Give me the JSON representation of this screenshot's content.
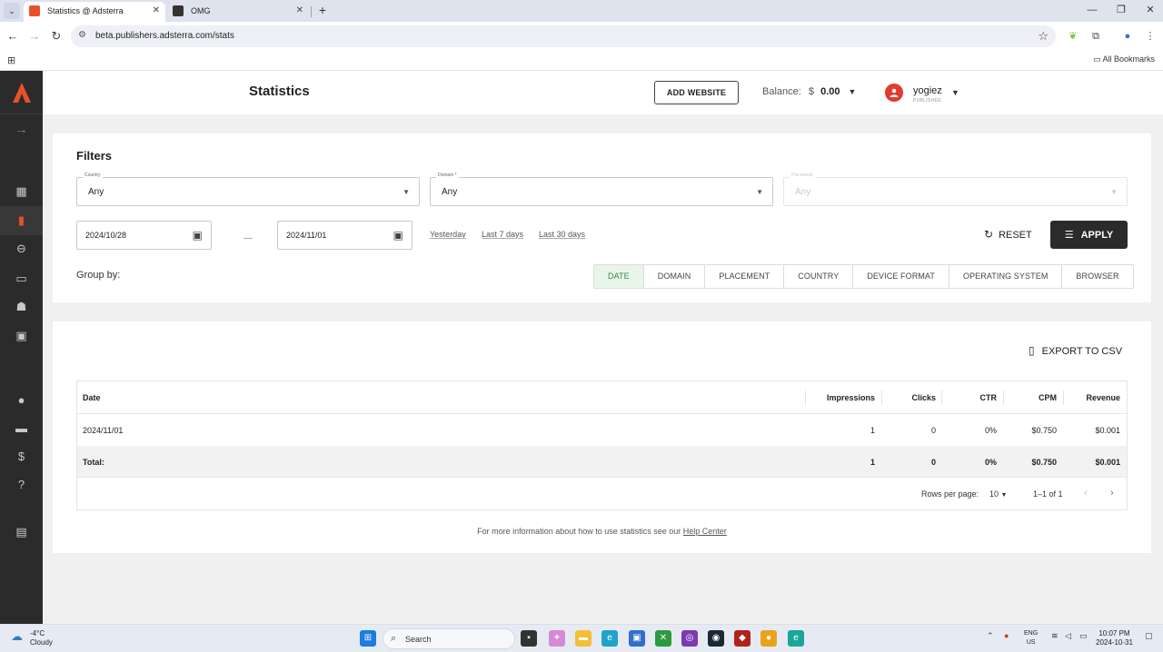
{
  "browser": {
    "tabs": [
      {
        "title": "Statistics @ Adsterra",
        "active": true
      },
      {
        "title": "OMG",
        "active": false
      }
    ],
    "url": "beta.publishers.adsterra.com/stats",
    "bookmarks_all": "All Bookmarks"
  },
  "colors": {
    "brand": "#e8512c",
    "sidebar": "#2b2b2b",
    "apply_bg": "#2b2b2b",
    "active_group": "#e8f5e9"
  },
  "header": {
    "title": "Statistics",
    "add_website": "ADD WEBSITE",
    "balance_label": "Balance:",
    "balance_currency": "$",
    "balance_value": "0.00",
    "user_name": "yogiez",
    "user_role": "PUBLISHER"
  },
  "sidebar": {
    "items": [
      "dashboard-icon",
      "statistics-icon",
      "links-icon",
      "websites-icon",
      "referrals-icon",
      "api-icon",
      "profile-icon",
      "payments-icon",
      "finance-icon",
      "help-icon",
      "wallet-icon"
    ]
  },
  "filters": {
    "title": "Filters",
    "country": {
      "label": "Country",
      "value": "Any"
    },
    "domain": {
      "label": "Domain *",
      "value": "Any"
    },
    "placement": {
      "label": "Placement",
      "value": "Any"
    },
    "date_from": "2024/10/28",
    "date_to": "2024/11/01",
    "dash": "—",
    "quick": [
      "Yesterday",
      "Last 7 days",
      "Last 30 days"
    ],
    "reset": "RESET",
    "apply": "APPLY",
    "group_by_label": "Group by:",
    "group_by": [
      "DATE",
      "DOMAIN",
      "PLACEMENT",
      "COUNTRY",
      "DEVICE FORMAT",
      "OPERATING SYSTEM",
      "BROWSER"
    ],
    "group_by_active": "DATE"
  },
  "results": {
    "export": "EXPORT TO CSV",
    "columns": [
      "Date",
      "Impressions",
      "Clicks",
      "CTR",
      "CPM",
      "Revenue"
    ],
    "rows": [
      {
        "date": "2024/11/01",
        "impressions": "1",
        "clicks": "0",
        "ctr": "0%",
        "cpm": "$0.750",
        "revenue": "$0.001"
      }
    ],
    "total": {
      "label": "Total:",
      "impressions": "1",
      "clicks": "0",
      "ctr": "0%",
      "cpm": "$0.750",
      "revenue": "$0.001"
    },
    "pager": {
      "rows_per_page_label": "Rows per page:",
      "rows_per_page": "10",
      "range": "1–1 of 1"
    },
    "info_text": "For more information about how to use statistics see our ",
    "info_link": "Help Center"
  },
  "taskbar": {
    "temp": "-4°C",
    "weather": "Cloudy",
    "search": "Search",
    "lang1": "ENG",
    "lang2": "US",
    "time": "10:07 PM",
    "date": "2024-10-31"
  }
}
